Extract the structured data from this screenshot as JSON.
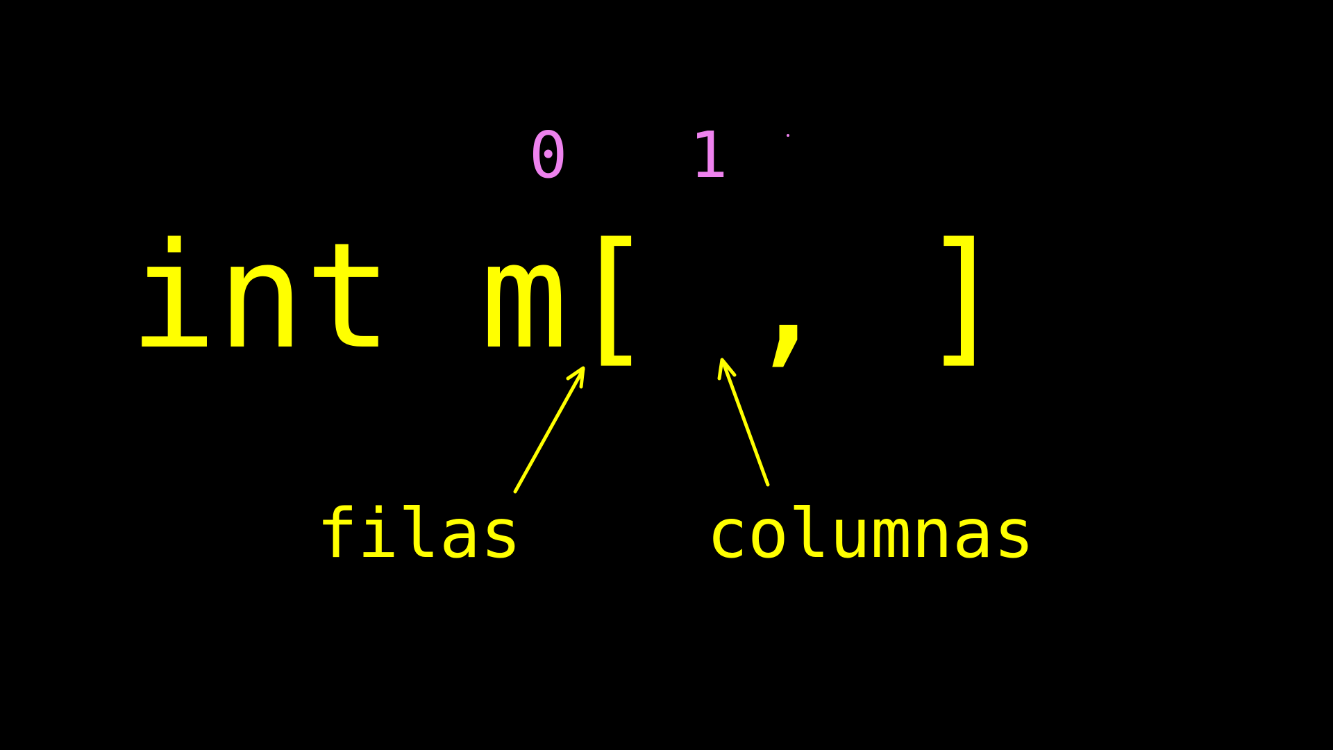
{
  "colors": {
    "background": "#000000",
    "code": "#FFFF00",
    "index": "#EE82EE",
    "labels": "#FFFF00",
    "arrows": "#FFFF00"
  },
  "indices": {
    "first": "0",
    "second": "1"
  },
  "code": {
    "line": "int m[ , ]"
  },
  "labels": {
    "rows": "filas",
    "columns": "columnas"
  }
}
